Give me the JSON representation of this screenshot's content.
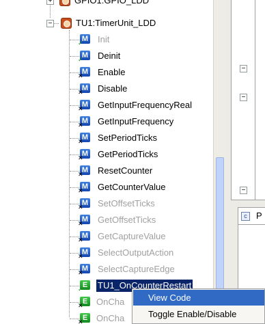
{
  "tree": {
    "gpio_label": "GPIO1:GPIO_LDD",
    "component_label": "TU1:TimerUnit_LDD",
    "methods": [
      {
        "label": "Init",
        "enabled": false,
        "mark": "check"
      },
      {
        "label": "Deinit",
        "enabled": true,
        "mark": "check"
      },
      {
        "label": "Enable",
        "enabled": true,
        "mark": "x"
      },
      {
        "label": "Disable",
        "enabled": true,
        "mark": "x"
      },
      {
        "label": "GetInputFrequencyReal",
        "enabled": true,
        "mark": "x"
      },
      {
        "label": "GetInputFrequency",
        "enabled": true,
        "mark": "x"
      },
      {
        "label": "SetPeriodTicks",
        "enabled": true,
        "mark": "x"
      },
      {
        "label": "GetPeriodTicks",
        "enabled": true,
        "mark": "x"
      },
      {
        "label": "ResetCounter",
        "enabled": true,
        "mark": "x"
      },
      {
        "label": "GetCounterValue",
        "enabled": true,
        "mark": "x"
      },
      {
        "label": "SetOffsetTicks",
        "enabled": false,
        "mark": "x"
      },
      {
        "label": "GetOffsetTicks",
        "enabled": false,
        "mark": "x"
      },
      {
        "label": "GetCaptureValue",
        "enabled": false,
        "mark": "x"
      },
      {
        "label": "SelectOutputAction",
        "enabled": false,
        "mark": "x"
      },
      {
        "label": "SelectCaptureEdge",
        "enabled": false,
        "mark": "x"
      }
    ],
    "events": [
      {
        "label": "TU1_OnCounterRestart",
        "selected": true,
        "mark": "check"
      },
      {
        "label": "OnCha",
        "selected": false,
        "mark": "x"
      },
      {
        "label": "OnCha",
        "selected": false,
        "mark": "x"
      }
    ]
  },
  "right_panel": {
    "tab_label": "P"
  },
  "context_menu": {
    "items": [
      {
        "label": "View Code",
        "highlighted": true
      },
      {
        "label": "Toggle Enable/Disable",
        "highlighted": false
      }
    ]
  }
}
